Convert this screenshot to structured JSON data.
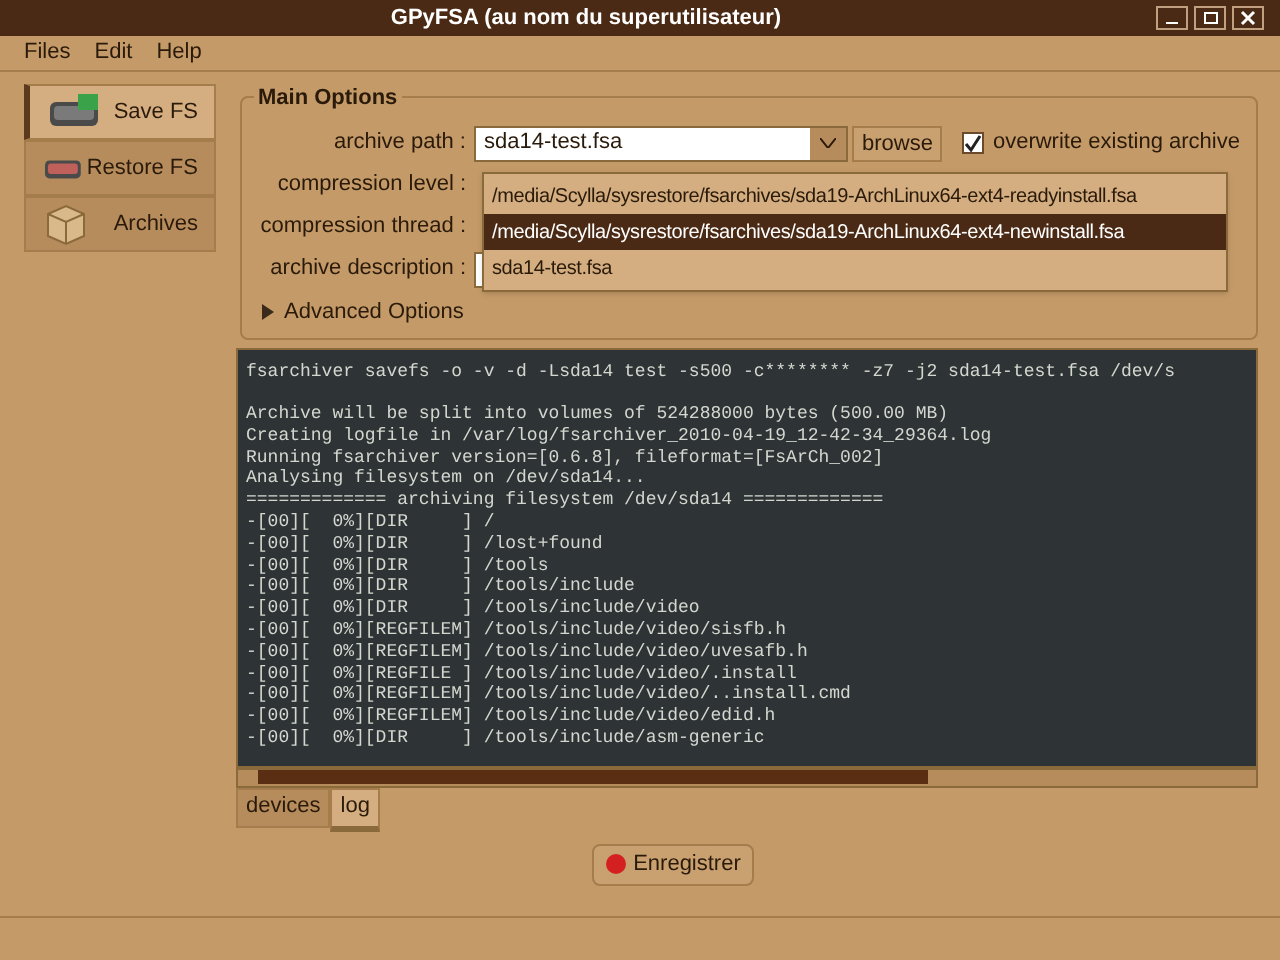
{
  "window": {
    "title": "GPyFSA (au nom du superutilisateur)"
  },
  "menu": [
    "Files",
    "Edit",
    "Help"
  ],
  "sidebar": [
    {
      "label": "Save FS",
      "selected": true
    },
    {
      "label": "Restore FS",
      "selected": false
    },
    {
      "label": "Archives",
      "selected": false
    }
  ],
  "main_options": {
    "title": "Main Options",
    "labels": [
      "archive path :",
      "compression level :",
      "compression thread :",
      "archive description :"
    ],
    "archive_path": "sda14-test.fsa",
    "browse": "browse",
    "overwrite": {
      "label": "overwrite existing archive",
      "checked": true
    },
    "dropdown": [
      {
        "label": "/media/Scylla/sysrestore/fsarchives/sda19-ArchLinux64-ext4-readyinstall.fsa",
        "selected": false
      },
      {
        "label": "/media/Scylla/sysrestore/fsarchives/sda19-ArchLinux64-ext4-newinstall.fsa",
        "selected": true
      },
      {
        "label": "sda14-test.fsa",
        "selected": false
      }
    ]
  },
  "advanced": {
    "label": "Advanced Options",
    "expanded": false
  },
  "log": [
    "fsarchiver savefs -o -v -d -Lsda14 test -s500 -c******** -z7 -j2 sda14-test.fsa /dev/s",
    "Archive will be split into volumes of 524288000 bytes (500.00 MB)",
    "Creating logfile in /var/log/fsarchiver_2010-04-19_12-42-34_29364.log",
    "Running fsarchiver version=[0.6.8], fileformat=[FsArCh_002]",
    "Analysing filesystem on /dev/sda14...",
    "============= archiving filesystem /dev/sda14 =============",
    "-[00][  0%][DIR     ] /",
    "-[00][  0%][DIR     ] /lost+found",
    "-[00][  0%][DIR     ] /tools",
    "-[00][  0%][DIR     ] /tools/include",
    "-[00][  0%][DIR     ] /tools/include/video",
    "-[00][  0%][REGFILEM] /tools/include/video/sisfb.h",
    "-[00][  0%][REGFILEM] /tools/include/video/uvesafb.h",
    "-[00][  0%][REGFILE ] /tools/include/video/.install",
    "-[00][  0%][REGFILEM] /tools/include/video/..install.cmd",
    "-[00][  0%][REGFILEM] /tools/include/video/edid.h",
    "-[00][  0%][DIR     ] /tools/include/asm-generic"
  ],
  "tabs": [
    {
      "label": "devices",
      "selected": false
    },
    {
      "label": "log",
      "selected": true
    }
  ],
  "action_button": "Enregistrer"
}
